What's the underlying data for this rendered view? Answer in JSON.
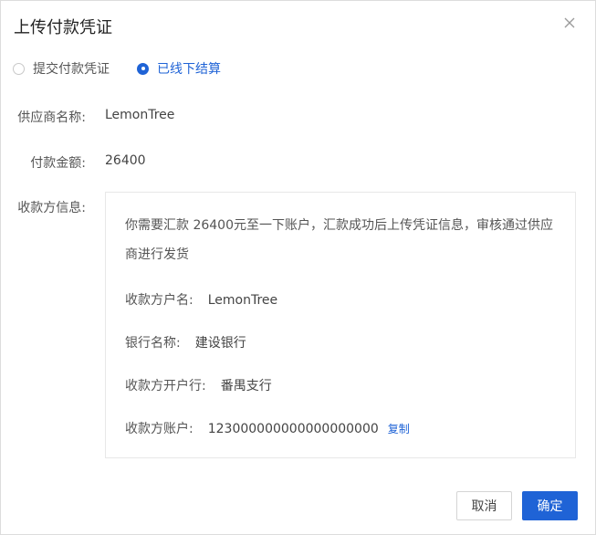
{
  "dialog": {
    "title": "上传付款凭证",
    "close_icon": "close-icon"
  },
  "payment_method": {
    "options": [
      {
        "label": "提交付款凭证",
        "selected": false
      },
      {
        "label": "已线下结算",
        "selected": true
      }
    ]
  },
  "fields": {
    "supplier_label": "供应商名称:",
    "supplier_value": "LemonTree",
    "amount_label": "付款金额:",
    "amount_value": "26400",
    "payee_label": "收款方信息:"
  },
  "payee_info": {
    "description": "你需要汇款 26400元至一下账户，汇款成功后上传凭证信息，审核通过供应商进行发货",
    "account_name_label": "收款方户名:",
    "account_name_value": "LemonTree",
    "bank_name_label": "银行名称:",
    "bank_name_value": "建设银行",
    "branch_label": "收款方开户行:",
    "branch_value": "番禺支行",
    "account_no_label": "收款方账户:",
    "account_no_value": "123000000000000000000",
    "copy_label": "复制"
  },
  "buttons": {
    "cancel_label": "取消",
    "ok_label": "确定"
  },
  "colors": {
    "accent": "#1f63d6",
    "border": "#dcdcdc"
  }
}
